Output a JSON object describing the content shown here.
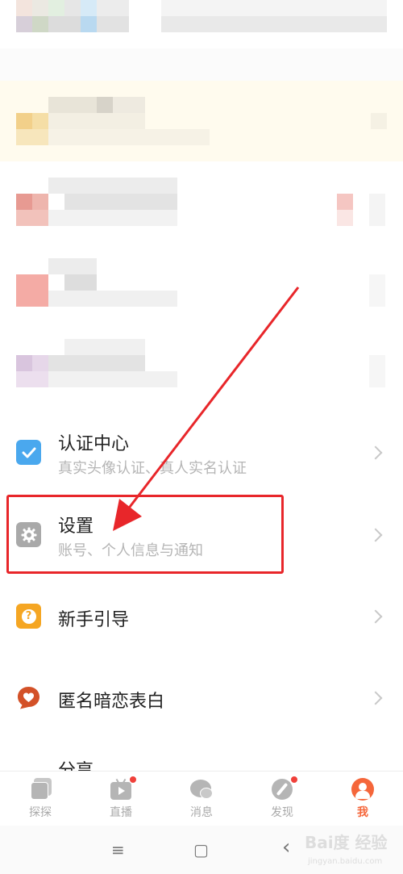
{
  "menu": [
    {
      "title": "认证中心",
      "subtitle": "真实头像认证、真人实名认证",
      "icon": "check-icon",
      "color": "#4aa8ee"
    },
    {
      "title": "设置",
      "subtitle": "账号、个人信息与通知",
      "icon": "gear-icon",
      "color": "#a9a9a9"
    },
    {
      "title": "新手引导",
      "subtitle": "",
      "icon": "question-icon",
      "color": "#f5a623"
    },
    {
      "title": "匿名暗恋表白",
      "subtitle": "",
      "icon": "heart-bubble-icon",
      "color": "#d35128"
    },
    {
      "title": "分享",
      "subtitle": "",
      "icon": "share-icon",
      "color": "#999999"
    }
  ],
  "tabs": [
    {
      "label": "探探",
      "icon": "cards-icon",
      "dot": false,
      "active": false
    },
    {
      "label": "直播",
      "icon": "tv-icon",
      "dot": true,
      "active": false
    },
    {
      "label": "消息",
      "icon": "chat-icon",
      "dot": false,
      "active": false
    },
    {
      "label": "发现",
      "icon": "compass-icon",
      "dot": true,
      "active": false
    },
    {
      "label": "我",
      "icon": "profile-icon",
      "dot": false,
      "active": true
    }
  ],
  "colors": {
    "accent": "#f5663a",
    "annotation_red": "#e8262a",
    "tab_inactive": "#aaaaaa"
  },
  "nav": {
    "menu": "≡",
    "home": "▢",
    "back": "‹"
  },
  "watermark": {
    "main": "Bai度 经验",
    "sub": "jingyan.baidu.com"
  }
}
